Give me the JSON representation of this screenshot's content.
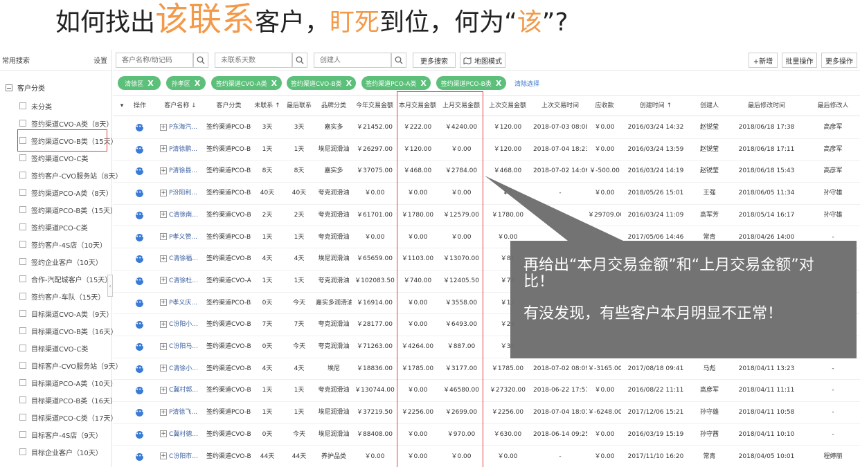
{
  "slide_title": {
    "part1": "如何找出",
    "highlight1": "该联系",
    "part2": "客户，",
    "highlight2": "盯死",
    "part3": "到位，何为“",
    "highlight3": "该",
    "part4": "”?"
  },
  "sidebar": {
    "title": "常用搜索",
    "settings_label": "设置",
    "root_label": "客户分类",
    "items": [
      "未分类",
      "签约渠道CVO-A类（8天）",
      "签约渠道CVO-B类（15天）",
      "签约渠道CVO-C类",
      "签约客户-CVO服务站（8天）",
      "签约渠道PCO-A类（8天）",
      "签约渠道PCO-B类（15天）",
      "签约渠道PCO-C类",
      "签约客户-4S店（10天）",
      "签约企业客户（10天）",
      "合作-汽配城客户（15天）",
      "签约客户-车队（15天）",
      "目标渠道CVO-A类（9天）",
      "目标渠道CVO-B类（16天）",
      "目标渠道CVO-C类",
      "目标客户-CVO服务站（9天）",
      "目标渠道PCO-A类（10天）",
      "目标渠道PCO-B类（16天）",
      "目标渠道PCO-C类（17天）",
      "目标客户-4S店（9天）",
      "目标企业客户（10天）"
    ]
  },
  "toolbar": {
    "search_name_placeholder": "客户名称/助记码",
    "search_days_placeholder": "未联系天数",
    "search_creator_placeholder": "创建人",
    "more_search_label": "更多搜索",
    "map_mode_label": "地图模式",
    "add_label": "+新增",
    "batch_label": "批量操作",
    "more_ops_label": "更多操作"
  },
  "filter_chips": [
    "清徐区",
    "孙孝区",
    "签约渠道CVO-A类",
    "签约渠道CVO-B类",
    "签约渠道PCO-A类",
    "签约渠道PCO-B类"
  ],
  "chip_close": "X",
  "clear_selection_label": "清除选择",
  "table": {
    "headers": [
      "操作",
      "客户名称 ↓",
      "客户分类",
      "未联系 ↑",
      "最后联系",
      "品牌分类",
      "今年交易金额",
      "本月交易金额",
      "上月交易金额",
      "上次交易金额",
      "上次交易时间",
      "应收款",
      "创建时间 ↑",
      "创建人",
      "最后修改时间",
      "最后修改人"
    ],
    "rows": [
      [
        "P东海汽...",
        "签约渠道PCO-B类",
        "3天",
        "3天",
        "嘉实多",
        "￥21452.00",
        "￥222.00",
        "￥4240.00",
        "￥120.00",
        "2018-07-03 08:08",
        "￥0.00",
        "2016/03/24 14:32",
        "赵锐莹",
        "2018/06/18 17:38",
        "高彦军"
      ],
      [
        "P清徐鹏...",
        "签约渠道PCO-B类",
        "1天",
        "1天",
        "埃尼润滑油",
        "￥26297.00",
        "￥120.00",
        "￥0.00",
        "￥120.00",
        "2018-07-04 18:23",
        "￥0.00",
        "2016/03/24 13:59",
        "赵锐莹",
        "2018/06/18 17:11",
        "高彦军"
      ],
      [
        "P清徐县...",
        "签约渠道PCO-B类",
        "8天",
        "8天",
        "嘉实多",
        "￥37075.00",
        "￥468.00",
        "￥2784.00",
        "￥468.00",
        "2018-07-02 14:06",
        "￥-500.00",
        "2016/03/24 14:19",
        "赵锐莹",
        "2018/06/18 15:43",
        "高彦军"
      ],
      [
        "P汾阳利...",
        "签约渠道PCO-B类",
        "40天",
        "40天",
        "夸克润滑油",
        "￥0.00",
        "￥0.00",
        "￥0.00",
        "￥0",
        "-",
        "￥0.00",
        "2018/05/26 15:01",
        "王强",
        "2018/06/05 11:34",
        "孙守雄"
      ],
      [
        "C清徐南...",
        "签约渠道CVO-B类",
        "2天",
        "2天",
        "夸克润滑油",
        "￥61701.00",
        "￥1780.00",
        "￥12579.00",
        "￥1780.00",
        "",
        "￥29709.00",
        "2016/03/24 11:09",
        "高军芳",
        "2018/05/14 16:17",
        "孙守雄"
      ],
      [
        "P孝义赞...",
        "签约渠道PCO-B类",
        "1天",
        "1天",
        "夸克润滑油",
        "￥0.00",
        "￥0.00",
        "￥0.00",
        "￥0.00",
        "",
        "",
        "2017/05/06 14:46",
        "常青",
        "2018/04/26 14:00",
        "-"
      ],
      [
        "C清徐福...",
        "签约渠道CVO-B类",
        "4天",
        "4天",
        "埃尼润滑油",
        "￥65659.00",
        "￥1103.00",
        "￥13070.00",
        "￥81",
        "",
        "",
        "",
        "",
        "",
        ""
      ],
      [
        "C清徐杜...",
        "签约渠道CVO-A类",
        "1天",
        "1天",
        "夸克润滑油",
        "￥102083.50",
        "￥740.00",
        "￥12405.50",
        "￥74",
        "",
        "",
        "",
        "",
        "",
        ""
      ],
      [
        "P孝义庆...",
        "签约渠道PCO-B类",
        "0天",
        "今天",
        "嘉实多润滑油",
        "￥16914.00",
        "￥0.00",
        "￥3558.00",
        "￥12",
        "",
        "",
        "",
        "",
        "",
        ""
      ],
      [
        "C汾阳小...",
        "签约渠道CVO-B类",
        "7天",
        "7天",
        "夸克润滑油",
        "￥28177.00",
        "￥0.00",
        "￥6493.00",
        "￥29",
        "",
        "",
        "",
        "",
        "",
        ""
      ],
      [
        "C汾阳马...",
        "签约渠道CVO-B类",
        "0天",
        "今天",
        "夸克润滑油",
        "￥71263.00",
        "￥4264.00",
        "￥887.00",
        "￥36",
        "",
        "",
        "",
        "",
        "",
        ""
      ],
      [
        "C清徐小...",
        "签约渠道CVO-B类",
        "4天",
        "4天",
        "埃尼",
        "￥18836.00",
        "￥1785.00",
        "￥3177.00",
        "￥1785.00",
        "2018-07-02 08:09",
        "￥-3165.00",
        "2017/08/18 09:41",
        "马彪",
        "2018/04/11 13:23",
        "-"
      ],
      [
        "C冀村郭...",
        "签约渠道CVO-B类",
        "1天",
        "1天",
        "夸克润滑油",
        "￥130744.00",
        "￥0.00",
        "￥46580.00",
        "￥27320.00",
        "2018-06-22 17:57",
        "￥0.00",
        "2016/08/22 11:11",
        "高彦军",
        "2018/04/11 11:11",
        "-"
      ],
      [
        "P清徐飞...",
        "签约渠道PCO-B类",
        "1天",
        "1天",
        "埃尼润滑油",
        "￥37219.50",
        "￥2256.00",
        "￥2699.00",
        "￥2256.00",
        "2018-07-04 18:01",
        "￥-6248.00",
        "2017/12/06 15:21",
        "孙守雄",
        "2018/04/11 10:58",
        "-"
      ],
      [
        "C冀村德...",
        "签约渠道CVO-B类",
        "0天",
        "今天",
        "埃尼润滑油",
        "￥88408.00",
        "￥0.00",
        "￥970.00",
        "￥630.00",
        "2018-06-14 09:25",
        "￥0.00",
        "2016/03/19 15:19",
        "孙守茜",
        "2018/04/11 10:10",
        "-"
      ],
      [
        "C汾阳市...",
        "签约渠道CVO-B类",
        "44天",
        "44天",
        "养护品类",
        "￥0.00",
        "￥0.00",
        "￥0.00",
        "￥0.00",
        "-",
        "￥0.00",
        "2017/11/10 16:20",
        "常青",
        "2018/04/05 10:01",
        "程婷丽"
      ]
    ]
  },
  "callout": {
    "line1": "再给出“本月交易金额”和“上月交易金额”对比！",
    "line2": "有没发现，有些客户本月明显不正常！",
    "color": "#6d6d6d"
  }
}
